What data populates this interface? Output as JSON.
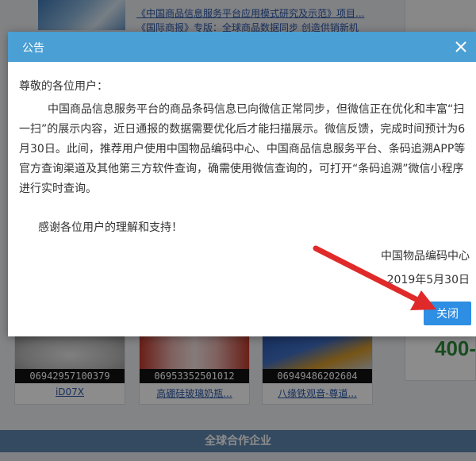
{
  "background": {
    "links": [
      "《中国商品信息服务平台应用模式研究及示范》项目...",
      "《国际商报》专版：全球商品数据同步 创造供销新机"
    ],
    "products": [
      {
        "code": "06942957100379",
        "name": "iD07X"
      },
      {
        "code": "06953352501012",
        "name": "高硼硅玻璃奶瓶..."
      },
      {
        "code": "06949486202604",
        "name": "八缘铁观音-尊道..."
      }
    ],
    "side_number": "400-",
    "footer_title": "全球合作企业"
  },
  "modal": {
    "title": "公告",
    "greeting": "尊敬的各位用户：",
    "paragraph": "中国商品信息服务平台的商品条码信息已向微信正常同步，但微信正在优化和丰富“扫一扫”的展示内容，近日通报的数据需要优化后才能扫描展示。微信反馈，完成时间预计为6月30日。此间，推荐用户使用中国物品编码中心、中国商品信息服务平台、条码追溯APP等官方查询渠道及其他第三方软件查询，确需使用微信查询的，可打开“条码追溯”微信小程序进行实时查询。",
    "thanks": "感谢各位用户的理解和支持！",
    "signature_org": "中国物品编码中心",
    "signature_date": "2019年5月30日",
    "close_button": "关闭"
  },
  "colors": {
    "header": "#4a9fd4",
    "button": "#2d8ee3",
    "arrow": "#e02a2a",
    "footer": "#5f87b0"
  },
  "icons": {
    "close": "close-icon",
    "annotation": "red-arrow-icon"
  }
}
